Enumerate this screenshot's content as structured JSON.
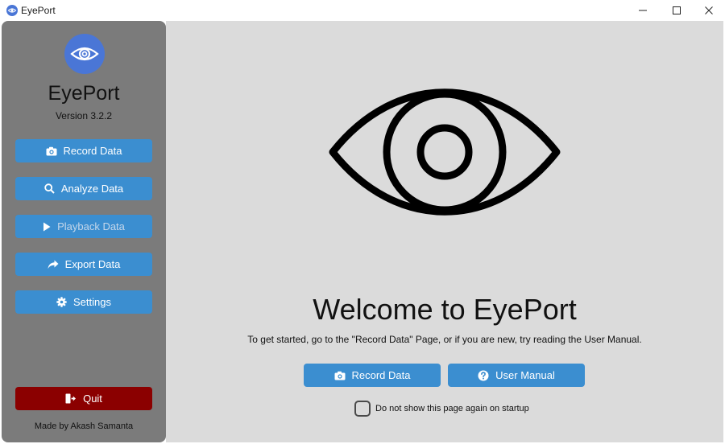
{
  "window": {
    "title": "EyePort",
    "minimize_glyph": "—",
    "maximize_glyph": "☐",
    "close_glyph": "✕"
  },
  "sidebar": {
    "app_name": "EyePort",
    "version": "Version 3.2.2",
    "buttons": [
      {
        "label": "Record Data",
        "icon": "camera-icon",
        "enabled": true
      },
      {
        "label": "Analyze Data",
        "icon": "search-icon",
        "enabled": true
      },
      {
        "label": "Playback Data",
        "icon": "play-icon",
        "enabled": false
      },
      {
        "label": "Export Data",
        "icon": "share-arrow-icon",
        "enabled": true
      },
      {
        "label": "Settings",
        "icon": "gear-icon",
        "enabled": true
      }
    ],
    "quit_label": "Quit",
    "credit": "Made by Akash Samanta"
  },
  "main": {
    "welcome": "Welcome to EyePort",
    "subtitle": "To get started, go to the \"Record Data\" Page, or if you are new, try reading the User Manual.",
    "record_button": "Record Data",
    "manual_button": "User Manual",
    "startup_checkbox_label": "Do not show this page again on startup",
    "startup_checkbox_checked": false
  },
  "colors": {
    "accent": "#3b8ed0",
    "logo": "#4a76d6",
    "quit": "#8b0000",
    "sidebar": "#7b7b7b",
    "main_bg": "#dbdbdb"
  }
}
